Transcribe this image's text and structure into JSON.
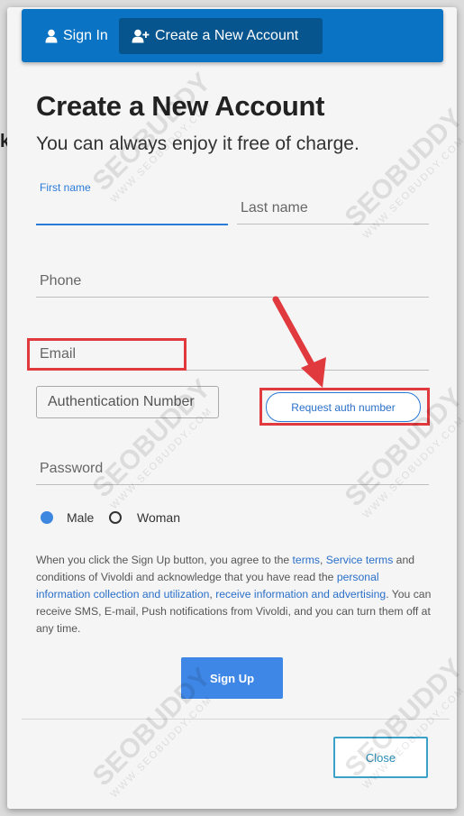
{
  "tabs": {
    "signin_label": "Sign In",
    "create_label": "Create a New Account"
  },
  "header": {
    "title": "Create a New Account",
    "subtitle": "You can always enjoy it free of charge."
  },
  "form": {
    "first_name_label": "First name",
    "last_name_placeholder": "Last name",
    "phone_placeholder": "Phone",
    "email_placeholder": "Email",
    "auth_placeholder": "Authentication Number",
    "request_auth_label": "Request auth number",
    "password_placeholder": "Password",
    "gender": {
      "selected": "Male",
      "options": [
        "Male",
        "Woman"
      ]
    }
  },
  "terms": {
    "part1": "When you click the Sign Up button, you agree to the ",
    "link_terms": "terms",
    "sep1": ", ",
    "link_service": "Service terms",
    "part2": " and conditions of Vivoldi and acknowledge that you have read the ",
    "link_personal": "personal information collection and utilization",
    "sep2": ", ",
    "link_receive": "receive information and advertising",
    "part3": ". You can receive SMS, E-mail, Push notifications from Vivoldi, and you can turn them off at any time."
  },
  "buttons": {
    "signup_label": "Sign Up",
    "close_label": "Close"
  },
  "watermark": {
    "brand": "SEOBUDDY",
    "url": "WWW.SEOBUDDY.COM"
  },
  "colors": {
    "tab_bar": "#0a73c4",
    "accent_blue": "#3f87e6",
    "annotation_red": "#e0393e"
  }
}
